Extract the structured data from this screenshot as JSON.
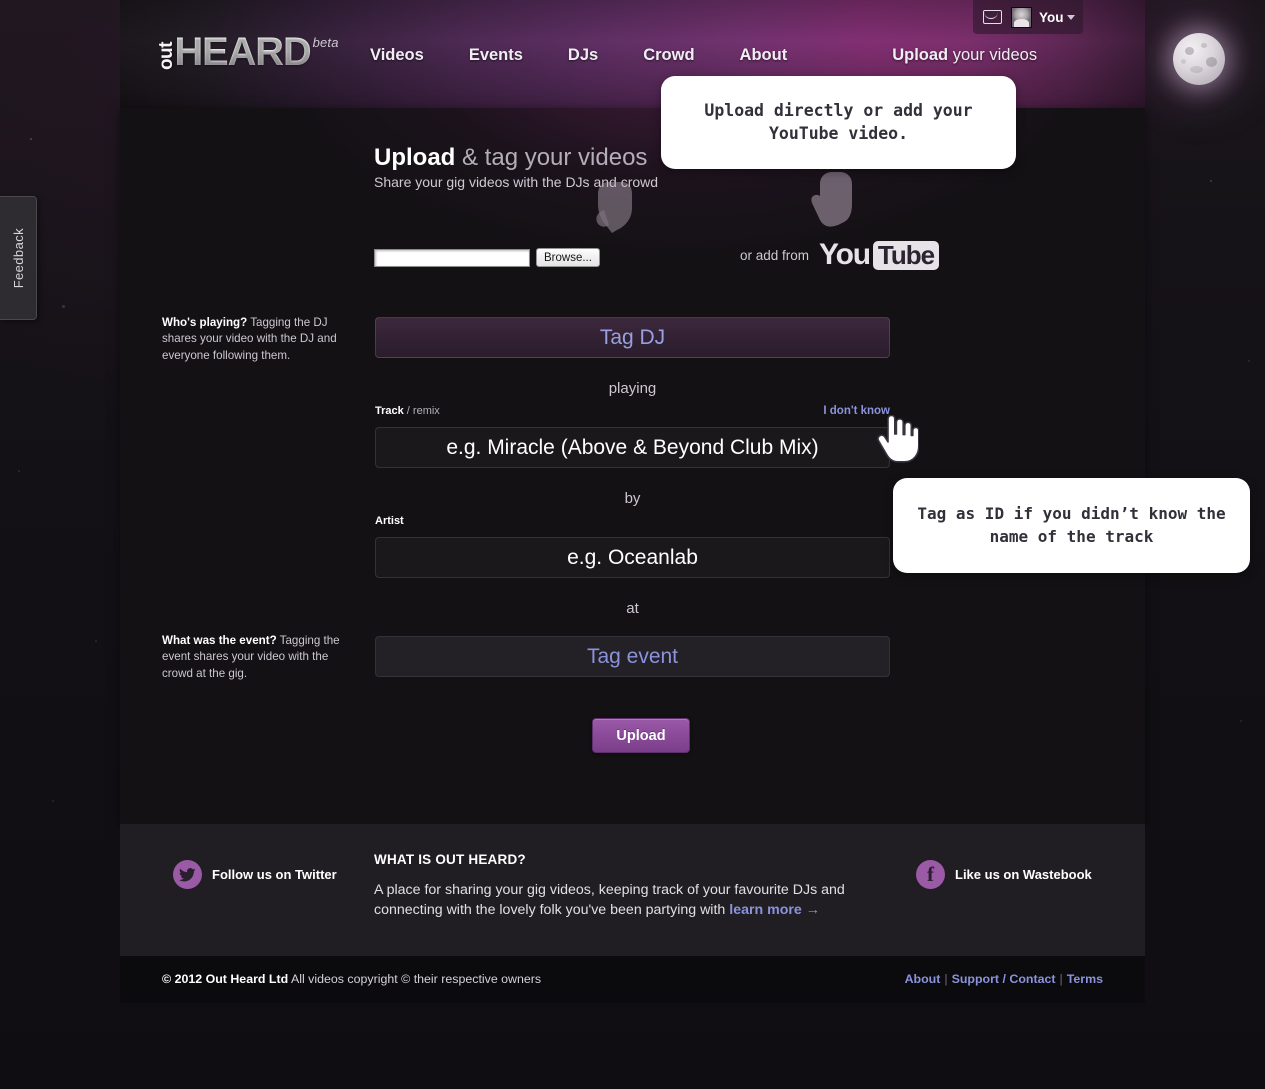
{
  "brand": {
    "logo_out": "out",
    "logo_heard": "HEARD",
    "logo_beta": "beta"
  },
  "header": {
    "nav": [
      {
        "label": "Videos",
        "name": "nav-videos"
      },
      {
        "label": "Events",
        "name": "nav-events"
      },
      {
        "label": "DJs",
        "name": "nav-djs"
      },
      {
        "label": "Crowd",
        "name": "nav-crowd"
      },
      {
        "label": "About",
        "name": "nav-about"
      }
    ],
    "upload_strong": "Upload",
    "upload_rest": " your videos",
    "user": {
      "label": "You",
      "inbox_icon": "envelope-icon",
      "avatar_icon": "user-avatar",
      "caret_icon": "chevron-down-icon"
    },
    "moon_icon": "moon-icon"
  },
  "feedback": {
    "label": "Feedback"
  },
  "main": {
    "heading_strong": "Upload",
    "heading_rest": " & tag your videos",
    "subheading": "Share your gig videos with the DJs and crowd",
    "file": {
      "value": "",
      "browse_label": "Browse...",
      "hand_icon": "hand-pointing-down-icon"
    },
    "youtube": {
      "prefix": "or add from",
      "logo_you": "You",
      "logo_tube": "Tube",
      "hand_icon": "hand-pointing-down-icon"
    },
    "dj_help_strong": "Who's playing?",
    "dj_help_rest": " Tagging the DJ shares your video with the DJ and everyone following them.",
    "tag_dj_placeholder": "Tag DJ",
    "connector_playing": "playing",
    "track_label_strong": "Track",
    "track_label_rest": " / remix",
    "dont_know_label": "I don't know",
    "track_placeholder": "e.g. Miracle (Above & Beyond Club Mix)",
    "connector_by": "by",
    "artist_label": "Artist",
    "artist_placeholder": "e.g. Oceanlab",
    "connector_at": "at",
    "event_help_strong": "What was the event?",
    "event_help_rest": " Tagging the event shares your video with the crowd at the gig.",
    "tag_event_placeholder": "Tag event",
    "upload_button_label": "Upload"
  },
  "tooltips": {
    "upload": "Upload directly or add your YouTube video.",
    "track_id": "Tag as ID if you didn’t know the name of the track",
    "cursor_icon": "hand-pointer-cursor"
  },
  "footer": {
    "twitter_label": "Follow us on Twitter",
    "twitter_icon": "twitter-bird-icon",
    "facebook_label": "Like us on Wastebook",
    "facebook_icon": "facebook-f-icon",
    "heading": "WHAT IS OUT HEARD?",
    "body": "A place for sharing your gig videos, keeping track of your favourite DJs and connecting with the lovely folk you've been partying with ",
    "link": "learn more →"
  },
  "bottom": {
    "copyright_strong": "© 2012 Out Heard Ltd",
    "copyright_rest": " All videos copyright © their respective owners",
    "links": [
      {
        "label": "About",
        "name": "bottom-link-about"
      },
      {
        "label": "Support / Contact",
        "name": "bottom-link-support"
      },
      {
        "label": "Terms",
        "name": "bottom-link-terms"
      }
    ]
  },
  "colors": {
    "accent_purple": "#9b5aa5",
    "link_periwinkle": "#8a93dc",
    "header_magenta": "#822f72",
    "panel_dark": "#131114"
  }
}
